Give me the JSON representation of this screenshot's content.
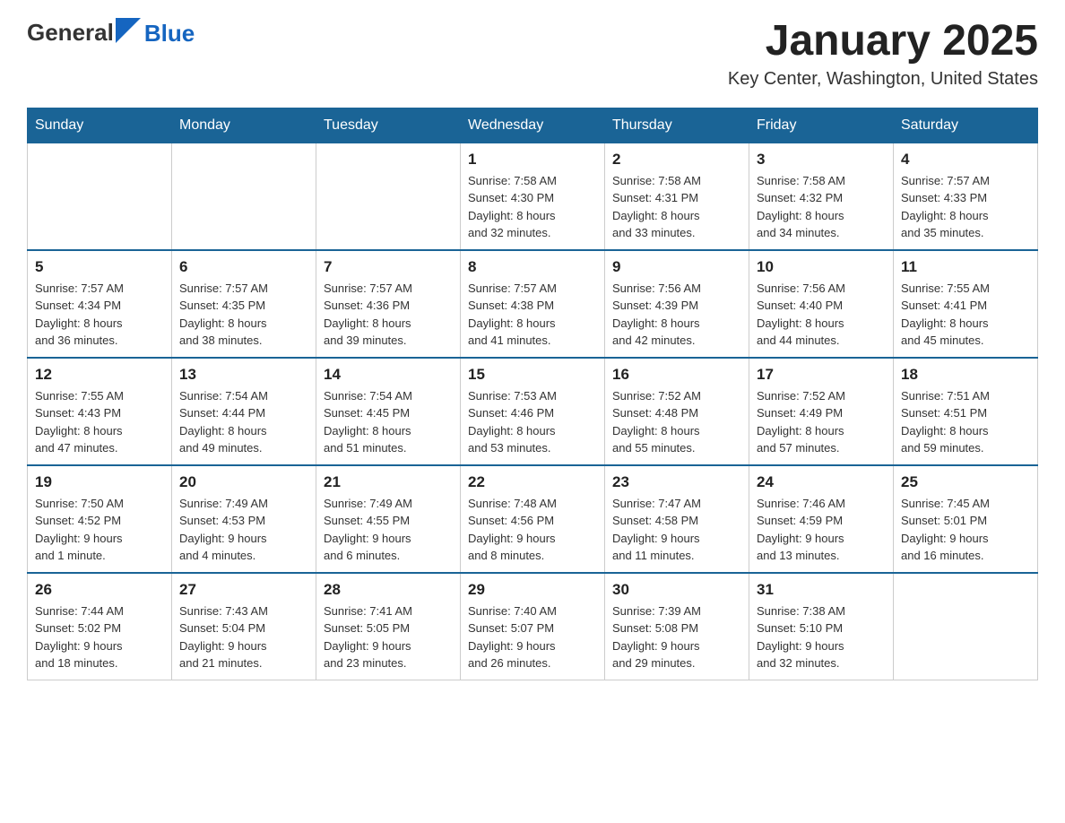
{
  "header": {
    "logo_general": "General",
    "logo_blue": "Blue",
    "month_title": "January 2025",
    "location": "Key Center, Washington, United States"
  },
  "days_of_week": [
    "Sunday",
    "Monday",
    "Tuesday",
    "Wednesday",
    "Thursday",
    "Friday",
    "Saturday"
  ],
  "weeks": [
    [
      {
        "day": "",
        "info": ""
      },
      {
        "day": "",
        "info": ""
      },
      {
        "day": "",
        "info": ""
      },
      {
        "day": "1",
        "info": "Sunrise: 7:58 AM\nSunset: 4:30 PM\nDaylight: 8 hours\nand 32 minutes."
      },
      {
        "day": "2",
        "info": "Sunrise: 7:58 AM\nSunset: 4:31 PM\nDaylight: 8 hours\nand 33 minutes."
      },
      {
        "day": "3",
        "info": "Sunrise: 7:58 AM\nSunset: 4:32 PM\nDaylight: 8 hours\nand 34 minutes."
      },
      {
        "day": "4",
        "info": "Sunrise: 7:57 AM\nSunset: 4:33 PM\nDaylight: 8 hours\nand 35 minutes."
      }
    ],
    [
      {
        "day": "5",
        "info": "Sunrise: 7:57 AM\nSunset: 4:34 PM\nDaylight: 8 hours\nand 36 minutes."
      },
      {
        "day": "6",
        "info": "Sunrise: 7:57 AM\nSunset: 4:35 PM\nDaylight: 8 hours\nand 38 minutes."
      },
      {
        "day": "7",
        "info": "Sunrise: 7:57 AM\nSunset: 4:36 PM\nDaylight: 8 hours\nand 39 minutes."
      },
      {
        "day": "8",
        "info": "Sunrise: 7:57 AM\nSunset: 4:38 PM\nDaylight: 8 hours\nand 41 minutes."
      },
      {
        "day": "9",
        "info": "Sunrise: 7:56 AM\nSunset: 4:39 PM\nDaylight: 8 hours\nand 42 minutes."
      },
      {
        "day": "10",
        "info": "Sunrise: 7:56 AM\nSunset: 4:40 PM\nDaylight: 8 hours\nand 44 minutes."
      },
      {
        "day": "11",
        "info": "Sunrise: 7:55 AM\nSunset: 4:41 PM\nDaylight: 8 hours\nand 45 minutes."
      }
    ],
    [
      {
        "day": "12",
        "info": "Sunrise: 7:55 AM\nSunset: 4:43 PM\nDaylight: 8 hours\nand 47 minutes."
      },
      {
        "day": "13",
        "info": "Sunrise: 7:54 AM\nSunset: 4:44 PM\nDaylight: 8 hours\nand 49 minutes."
      },
      {
        "day": "14",
        "info": "Sunrise: 7:54 AM\nSunset: 4:45 PM\nDaylight: 8 hours\nand 51 minutes."
      },
      {
        "day": "15",
        "info": "Sunrise: 7:53 AM\nSunset: 4:46 PM\nDaylight: 8 hours\nand 53 minutes."
      },
      {
        "day": "16",
        "info": "Sunrise: 7:52 AM\nSunset: 4:48 PM\nDaylight: 8 hours\nand 55 minutes."
      },
      {
        "day": "17",
        "info": "Sunrise: 7:52 AM\nSunset: 4:49 PM\nDaylight: 8 hours\nand 57 minutes."
      },
      {
        "day": "18",
        "info": "Sunrise: 7:51 AM\nSunset: 4:51 PM\nDaylight: 8 hours\nand 59 minutes."
      }
    ],
    [
      {
        "day": "19",
        "info": "Sunrise: 7:50 AM\nSunset: 4:52 PM\nDaylight: 9 hours\nand 1 minute."
      },
      {
        "day": "20",
        "info": "Sunrise: 7:49 AM\nSunset: 4:53 PM\nDaylight: 9 hours\nand 4 minutes."
      },
      {
        "day": "21",
        "info": "Sunrise: 7:49 AM\nSunset: 4:55 PM\nDaylight: 9 hours\nand 6 minutes."
      },
      {
        "day": "22",
        "info": "Sunrise: 7:48 AM\nSunset: 4:56 PM\nDaylight: 9 hours\nand 8 minutes."
      },
      {
        "day": "23",
        "info": "Sunrise: 7:47 AM\nSunset: 4:58 PM\nDaylight: 9 hours\nand 11 minutes."
      },
      {
        "day": "24",
        "info": "Sunrise: 7:46 AM\nSunset: 4:59 PM\nDaylight: 9 hours\nand 13 minutes."
      },
      {
        "day": "25",
        "info": "Sunrise: 7:45 AM\nSunset: 5:01 PM\nDaylight: 9 hours\nand 16 minutes."
      }
    ],
    [
      {
        "day": "26",
        "info": "Sunrise: 7:44 AM\nSunset: 5:02 PM\nDaylight: 9 hours\nand 18 minutes."
      },
      {
        "day": "27",
        "info": "Sunrise: 7:43 AM\nSunset: 5:04 PM\nDaylight: 9 hours\nand 21 minutes."
      },
      {
        "day": "28",
        "info": "Sunrise: 7:41 AM\nSunset: 5:05 PM\nDaylight: 9 hours\nand 23 minutes."
      },
      {
        "day": "29",
        "info": "Sunrise: 7:40 AM\nSunset: 5:07 PM\nDaylight: 9 hours\nand 26 minutes."
      },
      {
        "day": "30",
        "info": "Sunrise: 7:39 AM\nSunset: 5:08 PM\nDaylight: 9 hours\nand 29 minutes."
      },
      {
        "day": "31",
        "info": "Sunrise: 7:38 AM\nSunset: 5:10 PM\nDaylight: 9 hours\nand 32 minutes."
      },
      {
        "day": "",
        "info": ""
      }
    ]
  ]
}
